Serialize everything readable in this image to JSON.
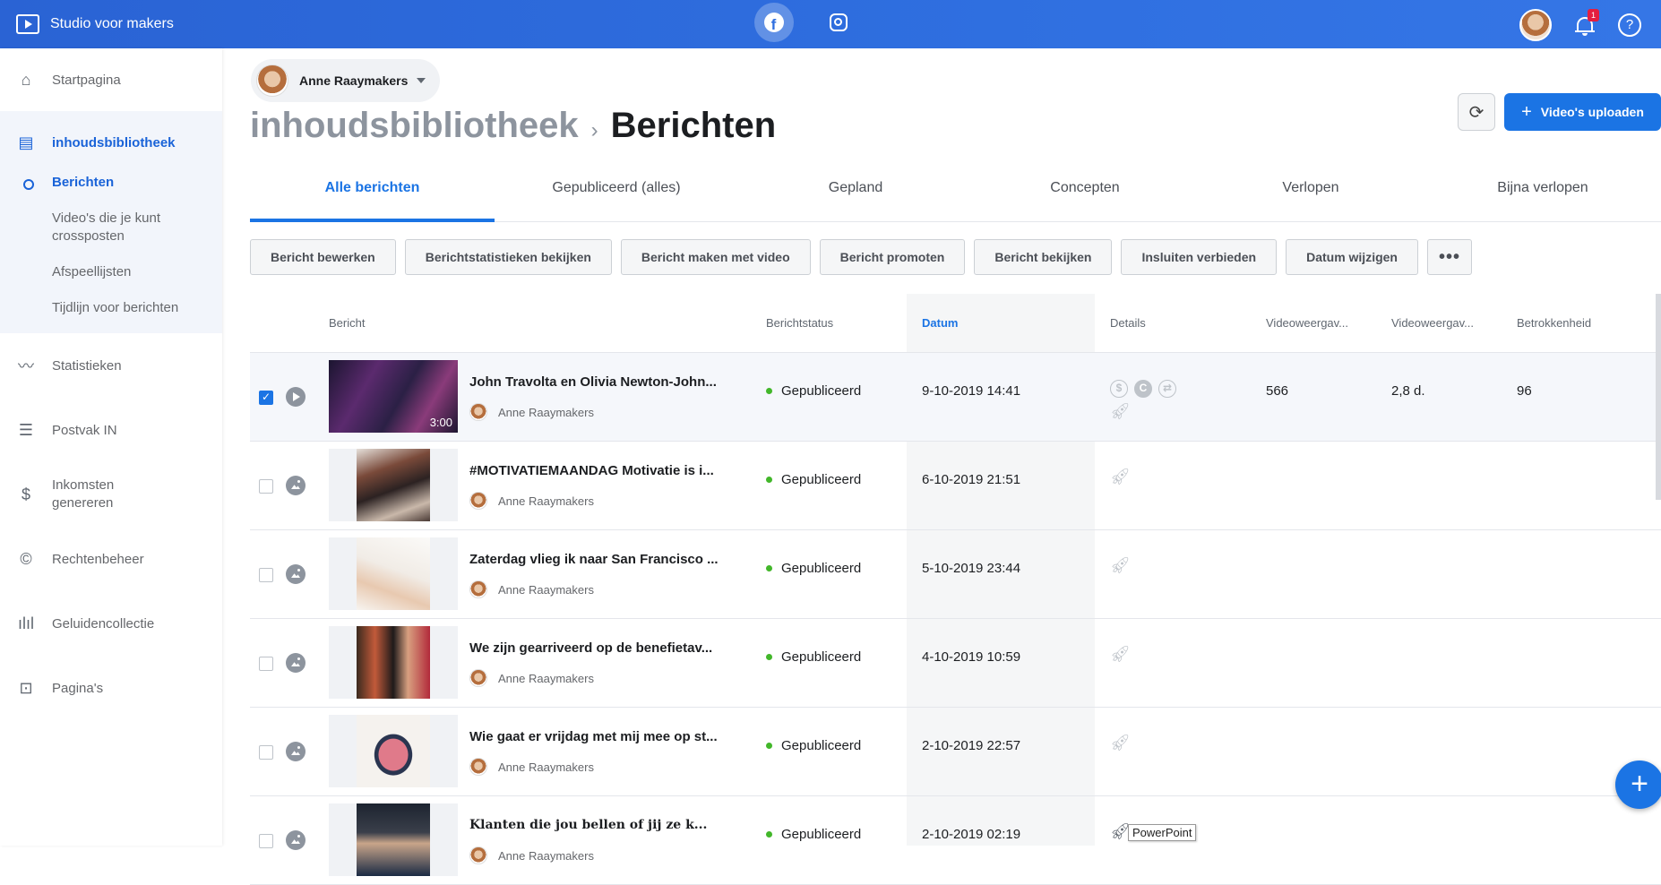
{
  "app": {
    "title": "Studio voor makers"
  },
  "topbar": {
    "notifications": "1",
    "help": "?"
  },
  "sidebar": {
    "items": [
      {
        "label": "Startpagina",
        "icon": "home-icon"
      },
      {
        "label": "inhoudsbibliotheek",
        "icon": "library-icon"
      },
      {
        "label": "Statistieken",
        "icon": "chart-icon"
      },
      {
        "label": "Postvak IN",
        "icon": "inbox-icon"
      },
      {
        "label": "Inkomsten genereren",
        "icon": "dollar-icon"
      },
      {
        "label": "Rechtenbeheer",
        "icon": "copyright-icon"
      },
      {
        "label": "Geluidencollectie",
        "icon": "sound-icon"
      },
      {
        "label": "Pagina's",
        "icon": "pages-icon"
      }
    ],
    "sub": [
      "Berichten",
      "Video's die je kunt crossposten",
      "Afspeellijsten",
      "Tijdlijn voor berichten"
    ]
  },
  "page_selector": {
    "name": "Anne Raaymakers"
  },
  "heading": {
    "crumb": "inhoudsbibliotheek",
    "current": "Berichten"
  },
  "buttons": {
    "upload": "Video's uploaden"
  },
  "tabs": [
    "Alle berichten",
    "Gepubliceerd (alles)",
    "Gepland",
    "Concepten",
    "Verlopen",
    "Bijna verlopen"
  ],
  "actions": [
    "Bericht bewerken",
    "Berichtstatistieken bekijken",
    "Bericht maken met video",
    "Bericht promoten",
    "Bericht bekijken",
    "Insluiten verbieden",
    "Datum wijzigen",
    "•••"
  ],
  "table": {
    "headers": [
      "Bericht",
      "Berichtstatus",
      "Datum",
      "Details",
      "Videoweergav...",
      "Videoweergav...",
      "Betrokkenheid"
    ],
    "rows": [
      {
        "title": "John Travolta en Olivia Newton-John...",
        "author": "Anne Raaymakers",
        "status": "Gepubliceerd",
        "date": "9-10-2019 14:41",
        "duration": "3:00",
        "vw1": "566",
        "vw2": "2,8 d.",
        "eng": "96",
        "selected": true,
        "type": "video"
      },
      {
        "title": "#MOTIVATIEMAANDAG Motivatie is i...",
        "author": "Anne Raaymakers",
        "status": "Gepubliceerd",
        "date": "6-10-2019 21:51",
        "type": "photo"
      },
      {
        "title": "Zaterdag vlieg ik naar San Francisco ...",
        "author": "Anne Raaymakers",
        "status": "Gepubliceerd",
        "date": "5-10-2019 23:44",
        "type": "photo"
      },
      {
        "title": "We zijn gearriveerd op de benefietav...",
        "author": "Anne Raaymakers",
        "status": "Gepubliceerd",
        "date": "4-10-2019 10:59",
        "type": "photo"
      },
      {
        "title": "Wie gaat er vrijdag met mij mee op st...",
        "author": "Anne Raaymakers",
        "status": "Gepubliceerd",
        "date": "2-10-2019 22:57",
        "type": "photo"
      },
      {
        "title": "Klanten die jou bellen of jij ze k...",
        "author": "Anne Raaymakers",
        "status": "Gepubliceerd",
        "date": "2-10-2019 02:19",
        "type": "photo"
      }
    ]
  },
  "tooltip": "PowerPoint",
  "fab": "+"
}
